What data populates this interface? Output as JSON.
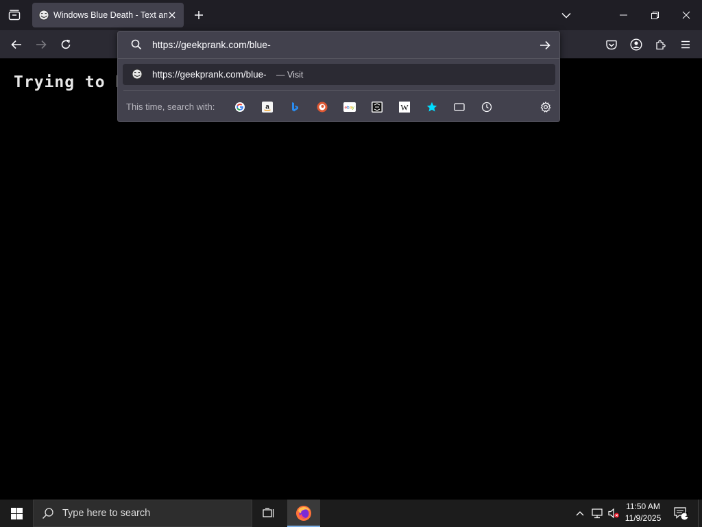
{
  "browser": {
    "tab": {
      "title": "Windows Blue Death - Text and Video Prank"
    },
    "urlbar": {
      "value": "https://geekprank.com/blue-"
    },
    "suggestion": {
      "url": "https://geekprank.com/blue-",
      "action": "— Visit"
    },
    "oneoff": {
      "label": "This time, search with:",
      "engines": [
        "google-icon",
        "amazon-icon",
        "bing-icon",
        "duckduckgo-icon",
        "ebay-icon",
        "ecosia-icon",
        "wikipedia-icon",
        "bookmarks-icon",
        "tabs-icon",
        "history-icon"
      ]
    }
  },
  "page": {
    "text": "Trying to b"
  },
  "taskbar": {
    "search_placeholder": "Type here to search",
    "time": "11:50 AM",
    "date": "11/9/2025",
    "notification_count": "1"
  },
  "colors": {
    "accent": "#00ddff",
    "tab_active": "#42414d",
    "toolbar": "#2b2a33",
    "tabstrip": "#1f1e25"
  }
}
